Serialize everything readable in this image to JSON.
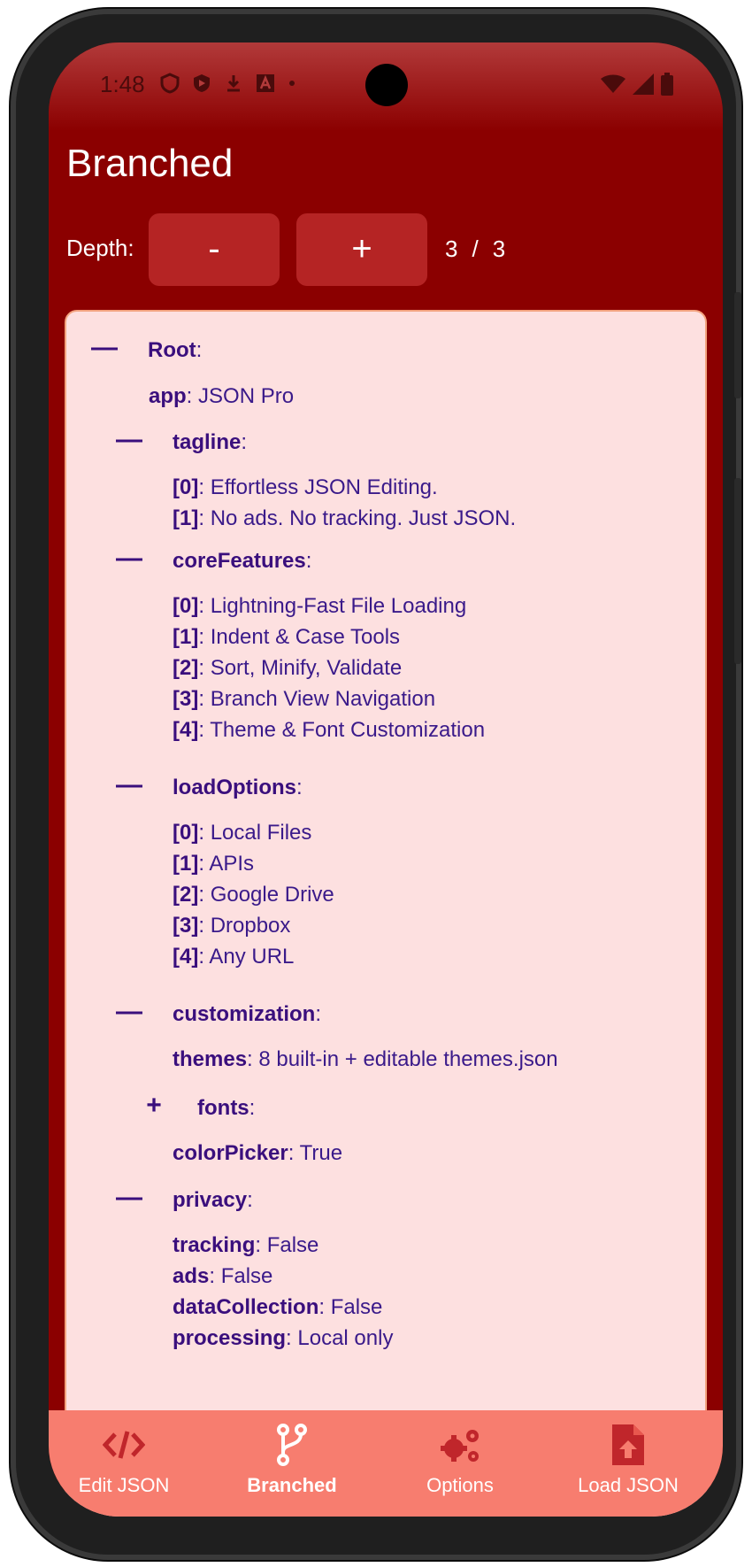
{
  "status": {
    "time": "1:48"
  },
  "header": {
    "title": "Branched"
  },
  "depth": {
    "label": "Depth:",
    "minus": "-",
    "plus": "+",
    "current": "3",
    "sep": "/",
    "max": "3"
  },
  "tree": {
    "toggle_collapse": "—",
    "toggle_expand": "+",
    "colon": ":",
    "nodes": [
      {
        "key": "Root",
        "value": ""
      },
      {
        "key": "app",
        "value": "JSON Pro"
      },
      {
        "key": "tagline",
        "value": ""
      },
      {
        "key": "[0]",
        "value": "Effortless JSON Editing."
      },
      {
        "key": "[1]",
        "value": "No ads. No tracking. Just JSON."
      },
      {
        "key": "coreFeatures",
        "value": ""
      },
      {
        "key": "[0]",
        "value": "Lightning-Fast File Loading"
      },
      {
        "key": "[1]",
        "value": "Indent & Case Tools"
      },
      {
        "key": "[2]",
        "value": "Sort, Minify, Validate"
      },
      {
        "key": "[3]",
        "value": "Branch View Navigation"
      },
      {
        "key": "[4]",
        "value": "Theme & Font Customization"
      },
      {
        "key": "loadOptions",
        "value": ""
      },
      {
        "key": "[0]",
        "value": "Local Files"
      },
      {
        "key": "[1]",
        "value": "APIs"
      },
      {
        "key": "[2]",
        "value": "Google Drive"
      },
      {
        "key": "[3]",
        "value": "Dropbox"
      },
      {
        "key": "[4]",
        "value": "Any URL"
      },
      {
        "key": "customization",
        "value": ""
      },
      {
        "key": "themes",
        "value": "8 built-in + editable themes.json"
      },
      {
        "key": "fonts",
        "value": ""
      },
      {
        "key": "colorPicker",
        "value": "True"
      },
      {
        "key": "privacy",
        "value": ""
      },
      {
        "key": "tracking",
        "value": "False"
      },
      {
        "key": "ads",
        "value": "False"
      },
      {
        "key": "dataCollection",
        "value": "False"
      },
      {
        "key": "processing",
        "value": "Local only"
      }
    ]
  },
  "nav": {
    "items": [
      {
        "label": "Edit JSON",
        "icon": "code-icon"
      },
      {
        "label": "Branched",
        "icon": "branch-icon"
      },
      {
        "label": "Options",
        "icon": "gears-icon"
      },
      {
        "label": "Load JSON",
        "icon": "file-upload-icon"
      }
    ]
  },
  "colors": {
    "accent": "#8b0000",
    "nav_bg": "#f77d6f",
    "card_bg": "#fde0e0",
    "text": "#3a0f7d"
  }
}
